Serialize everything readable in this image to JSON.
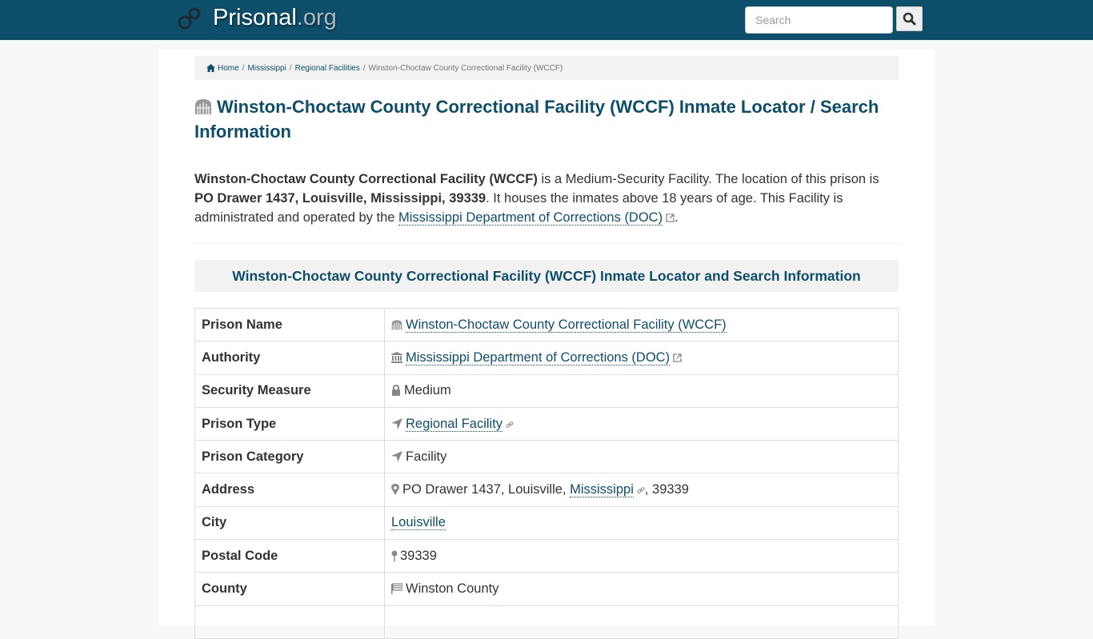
{
  "header": {
    "brand_name": "Prisonal",
    "brand_tld": ".org",
    "search_placeholder": "Search"
  },
  "breadcrumb": {
    "home": "Home",
    "state": "Mississippi",
    "category": "Regional Facilities",
    "current": "Winston-Choctaw County Correctional Facility (WCCF)",
    "separator": "/"
  },
  "page": {
    "title": "Winston-Choctaw County Correctional Facility (WCCF) Inmate Locator / Search Information",
    "intro": {
      "facility_name": "Winston-Choctaw County Correctional Facility (WCCF)",
      "text1": " is a Medium-Security Facility. The location of this prison is ",
      "address": "PO Drawer 1437, Louisville, Mississippi, 39339",
      "text2": ". It houses the inmates above 18 years of age. This Facility is administrated and operated by the ",
      "authority_link": "Mississippi Department of Corrections (DOC)",
      "text3": "."
    },
    "section_heading": "Winston-Choctaw County Correctional Facility (WCCF) Inmate Locator and Search Information"
  },
  "table": {
    "rows": [
      {
        "label": "Prison Name",
        "value": "Winston-Choctaw County Correctional Facility (WCCF)",
        "icon": "building-icon"
      },
      {
        "label": "Authority",
        "value": "Mississippi Department of Corrections (DOC)",
        "icon": "institution-icon"
      },
      {
        "label": "Security Measure",
        "value": "Medium",
        "icon": "lock-icon"
      },
      {
        "label": "Prison Type",
        "value": "Regional Facility",
        "icon": "location-arrow-icon"
      },
      {
        "label": "Prison Category",
        "value": "Facility",
        "icon": "location-arrow-icon"
      },
      {
        "label": "Address",
        "value_pre": "PO Drawer 1437, Louisville, ",
        "value_link": "Mississippi",
        "value_post": ", 39339",
        "icon": "map-marker-icon"
      },
      {
        "label": "City",
        "value": "Louisville"
      },
      {
        "label": "Postal Code",
        "value": "39339",
        "icon": "map-pin-icon"
      },
      {
        "label": "County",
        "value": "Winston County",
        "icon": "flag-icon"
      }
    ]
  },
  "colors": {
    "brand": "#0d4f6b",
    "link": "#0d4f6b"
  }
}
